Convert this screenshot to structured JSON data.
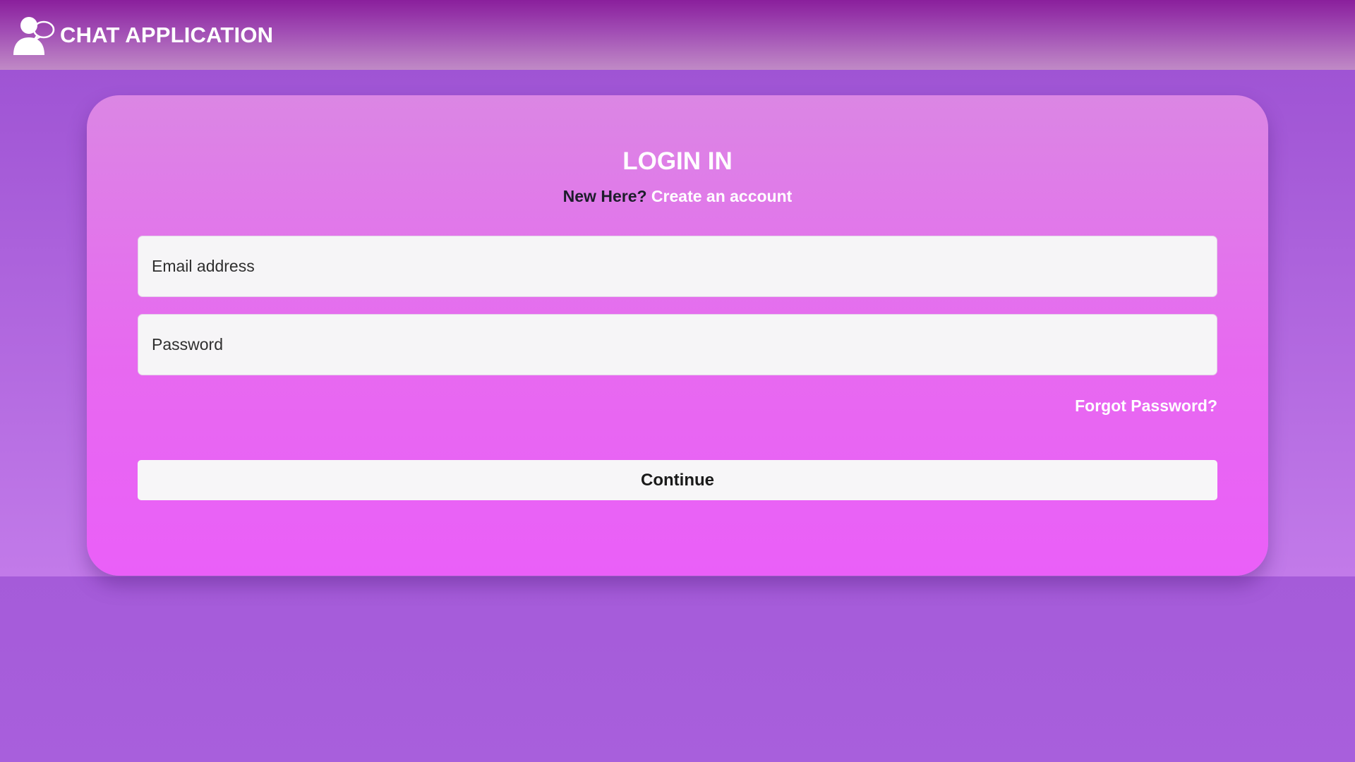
{
  "header": {
    "logo_icon": "user-chat-bubble-icon",
    "title": "CHAT APPLICATION"
  },
  "login": {
    "heading": "LOGIN IN",
    "new_here": "New Here?",
    "create_account": "Create an account",
    "email_placeholder": "Email address",
    "password_placeholder": "Password",
    "forgot_password": "Forgot Password?",
    "continue_label": "Continue"
  },
  "colors": {
    "header_gradient_top": "#8a1f9c",
    "page_background": "#9c4fd0",
    "card_gradient_top": "#db86e4",
    "card_gradient_bottom": "#ea5ff8",
    "link_text": "#ffffff"
  }
}
